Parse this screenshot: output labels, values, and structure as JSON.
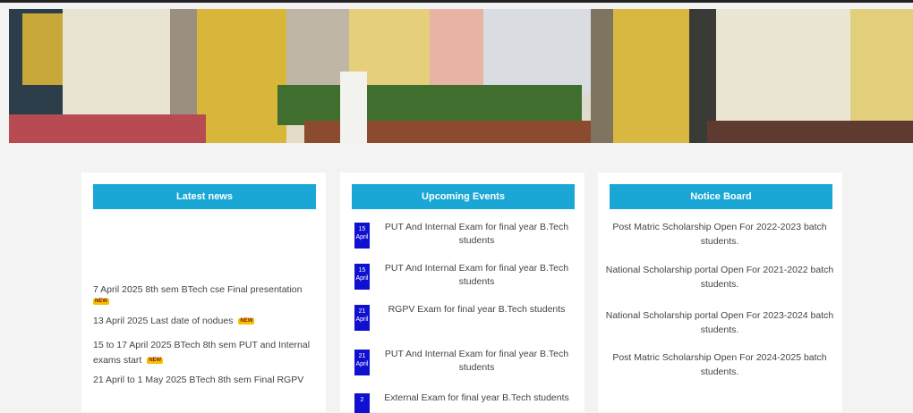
{
  "news": {
    "title": "Latest news",
    "new_label": "NEW",
    "items": [
      {
        "text": "7 April 2025 8th sem BTech cse Final presentation"
      },
      {
        "text": "13 April 2025 Last date of nodues"
      },
      {
        "text": "15 to 17 April 2025 BTech 8th sem PUT and Internal exams start"
      },
      {
        "text": "21 April to 1 May 2025 BTech 8th sem Final RGPV"
      }
    ]
  },
  "events": {
    "title": "Upcoming Events",
    "items": [
      {
        "day": "15",
        "month": "April",
        "text": "PUT And Internal Exam for final year B.Tech students"
      },
      {
        "day": "15",
        "month": "April",
        "text": "PUT And Internal Exam for final year B.Tech students"
      },
      {
        "day": "21",
        "month": "April",
        "text": "RGPV Exam for final year B.Tech students"
      },
      {
        "day": "21",
        "month": "April",
        "text": "PUT And Internal Exam for final year B.Tech students"
      },
      {
        "day": "2",
        "month": "",
        "text": "External Exam for final year B.Tech students"
      }
    ]
  },
  "notice": {
    "title": "Notice Board",
    "items": [
      {
        "text": "Post Matric Scholarship Open For 2022-2023 batch students."
      },
      {
        "text": "National Scholarship portal Open For 2021-2022 batch students."
      },
      {
        "text": "National Scholarship portal Open For 2023-2024 batch students."
      },
      {
        "text": "Post Matric Scholarship Open For 2024-2025 batch students."
      }
    ]
  },
  "colors": {
    "header_blue": "#1aa7d6",
    "date_blue": "#1010d0",
    "badge_yellow": "#f2c200"
  }
}
